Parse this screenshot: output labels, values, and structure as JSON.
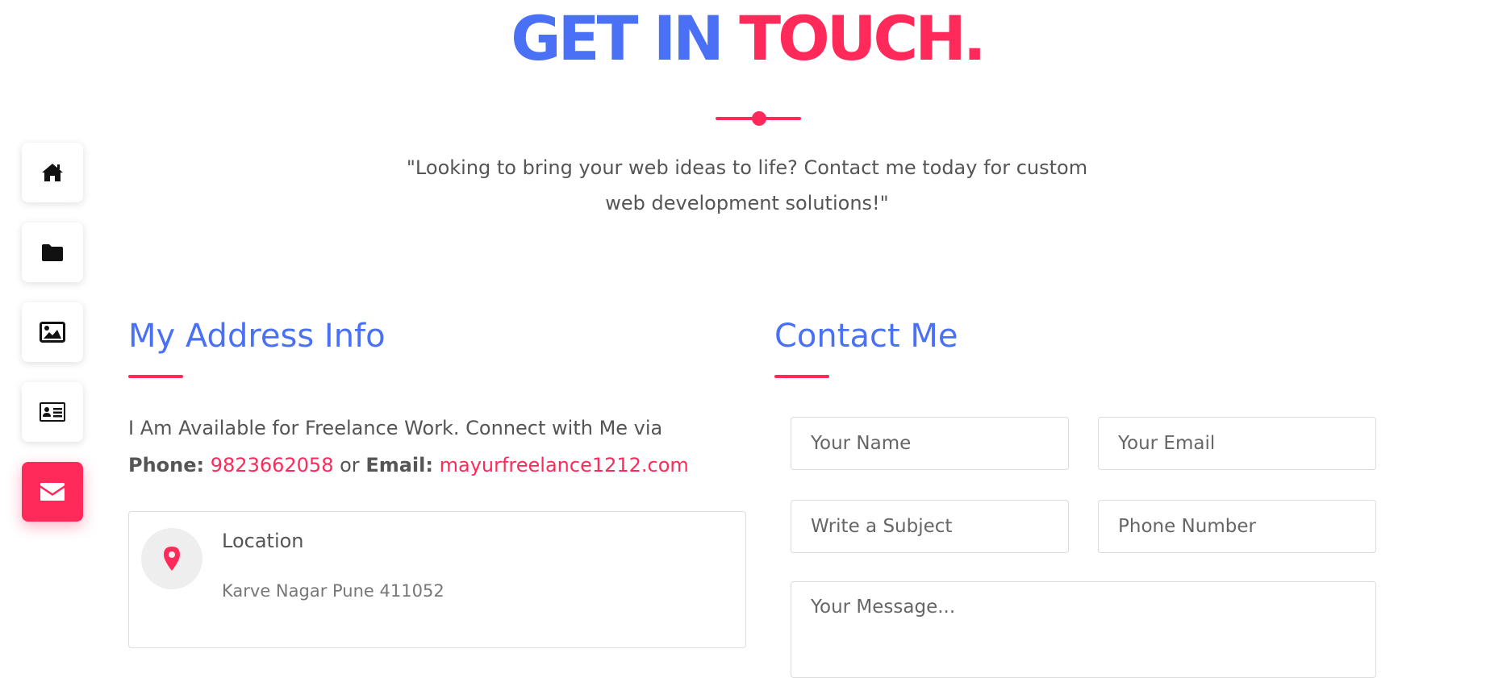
{
  "header": {
    "title_word1": "GET",
    "title_word2": "IN",
    "title_word3": "TOUCH.",
    "subtitle": "\"Looking to bring your web ideas to life? Contact me today for custom web development solutions!\""
  },
  "side_nav": {
    "items": [
      {
        "icon": "home-icon"
      },
      {
        "icon": "folder-icon"
      },
      {
        "icon": "image-icon"
      },
      {
        "icon": "id-card-icon"
      },
      {
        "icon": "envelope-icon",
        "active": true
      }
    ]
  },
  "address": {
    "heading": "My Address Info",
    "intro": "I Am Available for Freelance Work. Connect with Me via",
    "phone_label": "Phone:",
    "phone_value": "9823662058",
    "or_text": "or",
    "email_label": "Email:",
    "email_value": "mayurfreelance1212.com",
    "location_title": "Location",
    "location_value": "Karve Nagar Pune 411052"
  },
  "contact": {
    "heading": "Contact Me",
    "name_placeholder": "Your Name",
    "email_placeholder": "Your Email",
    "subject_placeholder": "Write a Subject",
    "phone_placeholder": "Phone Number",
    "message_placeholder": "Your Message..."
  },
  "colors": {
    "primary_blue": "#4a70f5",
    "accent_pink": "#ff2a5a",
    "text_gray": "#555555"
  }
}
